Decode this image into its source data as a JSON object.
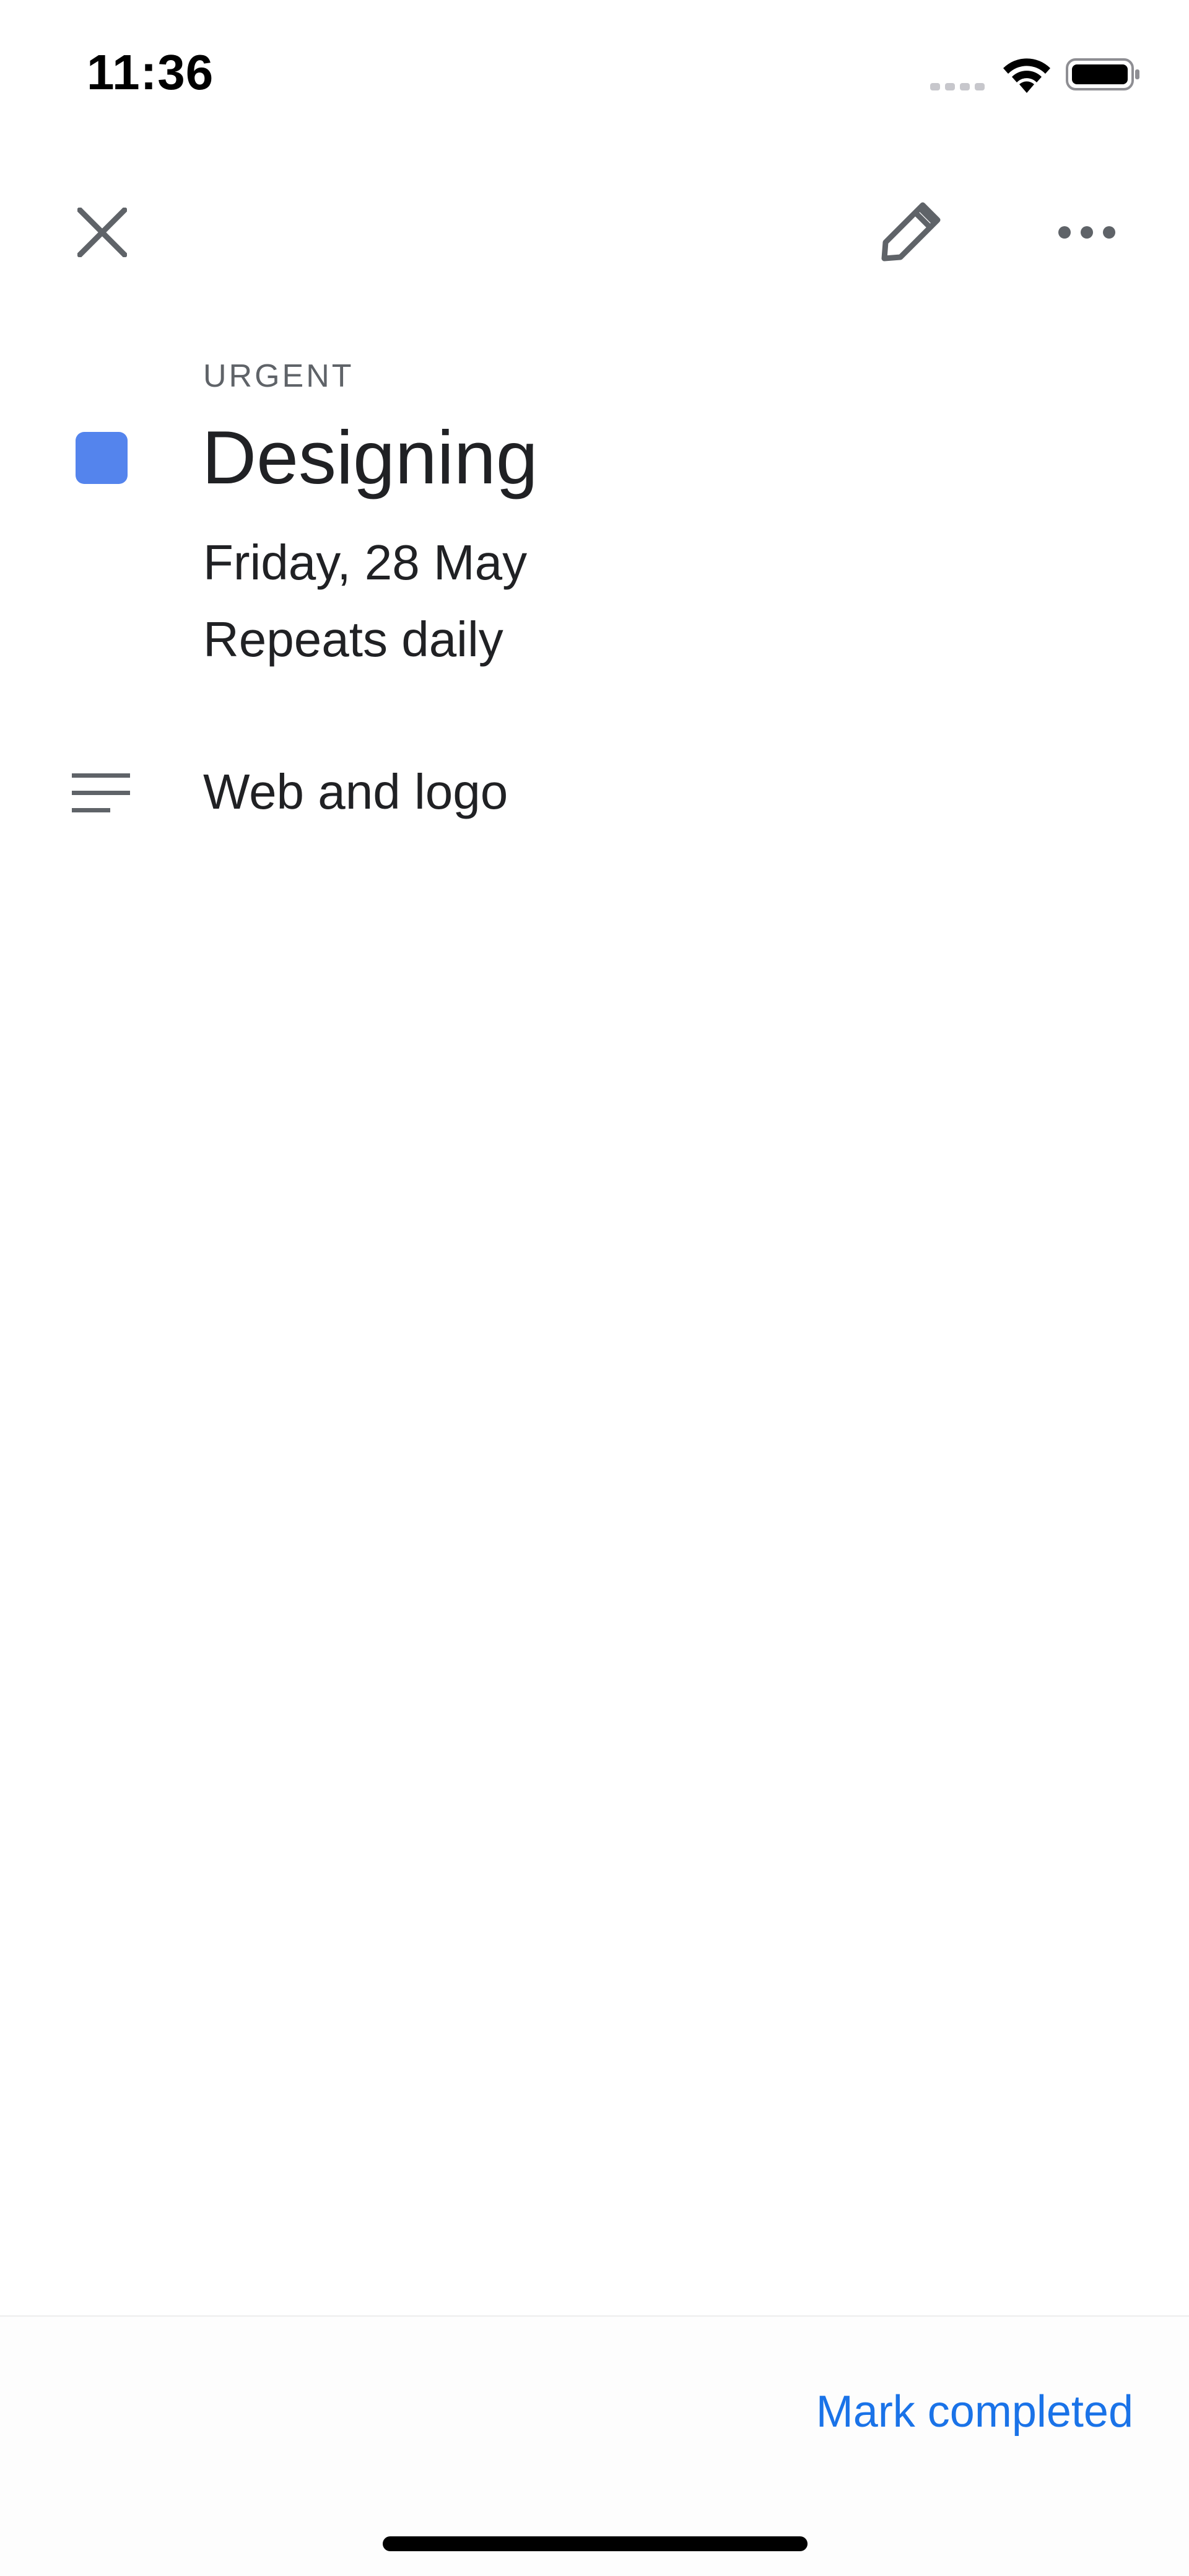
{
  "status_bar": {
    "time": "11:36",
    "icons": [
      "cellular-signal-icon",
      "wifi-icon",
      "battery-icon"
    ]
  },
  "toolbar": {
    "close_icon": "close-icon",
    "edit_icon": "pencil-icon",
    "more_icon": "more-horizontal-icon"
  },
  "task": {
    "category": "URGENT",
    "color": "#5484ed",
    "title": "Designing",
    "date": "Friday, 28 May",
    "repeat": "Repeats daily",
    "notes_icon": "notes-icon",
    "notes": "Web and logo"
  },
  "footer": {
    "mark_completed": "Mark completed",
    "accent_color": "#1a73e8"
  }
}
